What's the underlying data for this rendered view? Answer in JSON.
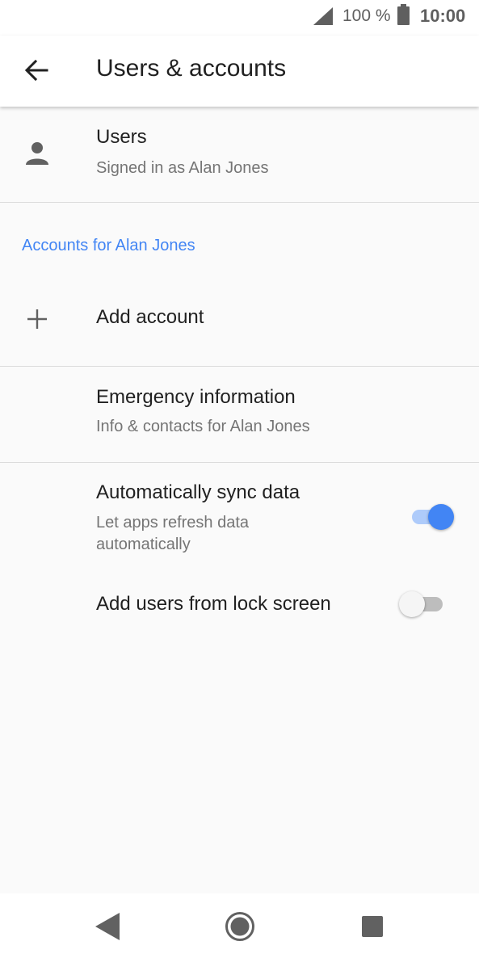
{
  "status_bar": {
    "battery_percent": "100 %",
    "time": "10:00",
    "icons": [
      "cell-signal-icon",
      "battery-icon"
    ]
  },
  "app_bar": {
    "title": "Users & accounts",
    "back_icon": "arrow-back-icon"
  },
  "users_row": {
    "title": "Users",
    "summary": "Signed in as Alan Jones",
    "icon": "person-icon"
  },
  "accounts_section": {
    "header": "Accounts for Alan Jones",
    "header_color": "#4285f4"
  },
  "add_account_row": {
    "title": "Add account",
    "icon": "plus-icon"
  },
  "emergency_row": {
    "title": "Emergency information",
    "summary": "Info & contacts for Alan Jones"
  },
  "sync_row": {
    "title": "Automatically sync data",
    "summary": "Let apps refresh data automatically",
    "enabled": true
  },
  "lockscreen_row": {
    "title": "Add users from lock screen",
    "enabled": false
  },
  "nav_bar": {
    "icons": [
      "nav-back-icon",
      "nav-home-icon",
      "nav-recents-icon"
    ]
  },
  "colors": {
    "accent": "#4285f4",
    "switch_track_on": "#aecbfa",
    "background": "#fafafa"
  }
}
